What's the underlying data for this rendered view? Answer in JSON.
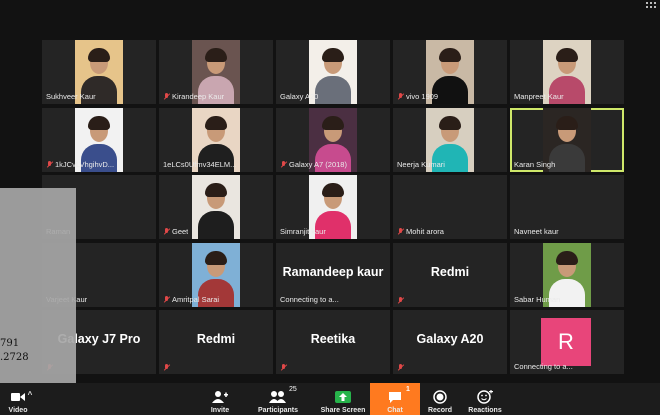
{
  "participants": [
    {
      "name": "Sukhveer Kaur",
      "muted": false,
      "video": {
        "bg": "#e6c48a",
        "body": "#2f2a28"
      }
    },
    {
      "name": "Kirandeep Kaur",
      "muted": true,
      "video": {
        "bg": "#6a5450",
        "body": "#c9a6b0"
      }
    },
    {
      "name": "Galaxy A20",
      "muted": false,
      "video": {
        "bg": "#f3efe9",
        "body": "#6a6f7a"
      }
    },
    {
      "name": "vivo 1909",
      "muted": true,
      "video": {
        "bg": "#c9b9a5",
        "body": "#111111"
      }
    },
    {
      "name": "Manpreet Kaur",
      "muted": false,
      "video": {
        "bg": "#ddd3c2",
        "body": "#b84a6a"
      }
    },
    {
      "name": "1kJCvLVhgihvD...",
      "muted": true,
      "video": {
        "bg": "#f2f2f2",
        "body": "#3a4e8c"
      }
    },
    {
      "name": "1eLCs0Ufmv34ELM...",
      "muted": false,
      "video": {
        "bg": "#e9d6c4",
        "body": "#1f1f1f"
      }
    },
    {
      "name": "Galaxy A7 (2018)",
      "muted": true,
      "video": {
        "bg": "#4b2f42",
        "body": "#c74b8e"
      }
    },
    {
      "name": "Neerja Kumari",
      "muted": false,
      "video": {
        "bg": "#d7cfc0",
        "body": "#20b5b5"
      }
    },
    {
      "name": "Karan Singh",
      "muted": false,
      "video": {
        "bg": "#2b2623",
        "body": "#3a3a3a"
      }
    },
    {
      "name": "Raman",
      "muted": false
    },
    {
      "name": "Geet",
      "muted": true,
      "video": {
        "bg": "#eae6e0",
        "body": "#1e1e1e"
      }
    },
    {
      "name": "Simranjit kaur",
      "muted": false,
      "video": {
        "bg": "#f0f0f0",
        "body": "#e0306a"
      }
    },
    {
      "name": "Mohit arora",
      "muted": true
    },
    {
      "name": "Navneet kaur",
      "muted": false
    },
    {
      "name": "Varjeet Kaur",
      "muted": false
    },
    {
      "name": "Amritpal Sarai",
      "muted": true,
      "video": {
        "bg": "#7fb0d6",
        "body": "#a33838"
      }
    },
    {
      "name": "Connecting to a...",
      "muted": false,
      "big": "Ramandeep kaur"
    },
    {
      "name": "",
      "muted": true,
      "big": "Redmi"
    },
    {
      "name": "Sabar Human",
      "muted": false,
      "video": {
        "bg": "#6f9c48",
        "body": "#f2f2f2"
      }
    },
    {
      "name": "",
      "muted": true,
      "big": "Galaxy J7 Pro"
    },
    {
      "name": "",
      "muted": true,
      "big": "Redmi"
    },
    {
      "name": "",
      "muted": true,
      "big": "Reetika"
    },
    {
      "name": "",
      "muted": true,
      "big": "Galaxy A20"
    },
    {
      "name": "Connecting to a...",
      "muted": false,
      "avatar": "R"
    }
  ],
  "left_panel": {
    "line1": "791",
    "line2": ".2728"
  },
  "toolbar": {
    "video_label": "Video",
    "invite_label": "Invite",
    "participants_label": "Participants",
    "participants_count": "25",
    "share_label": "Share Screen",
    "chat_label": "Chat",
    "chat_badge": "1",
    "record_label": "Record",
    "reactions_label": "Reactions"
  },
  "colors": {
    "active_speaker": "#cfe86a",
    "chat_bg": "#ff7a1f",
    "avatar_bg": "#e8457a",
    "muted_icon": "#e04848",
    "share_icon": "#27b34b"
  }
}
